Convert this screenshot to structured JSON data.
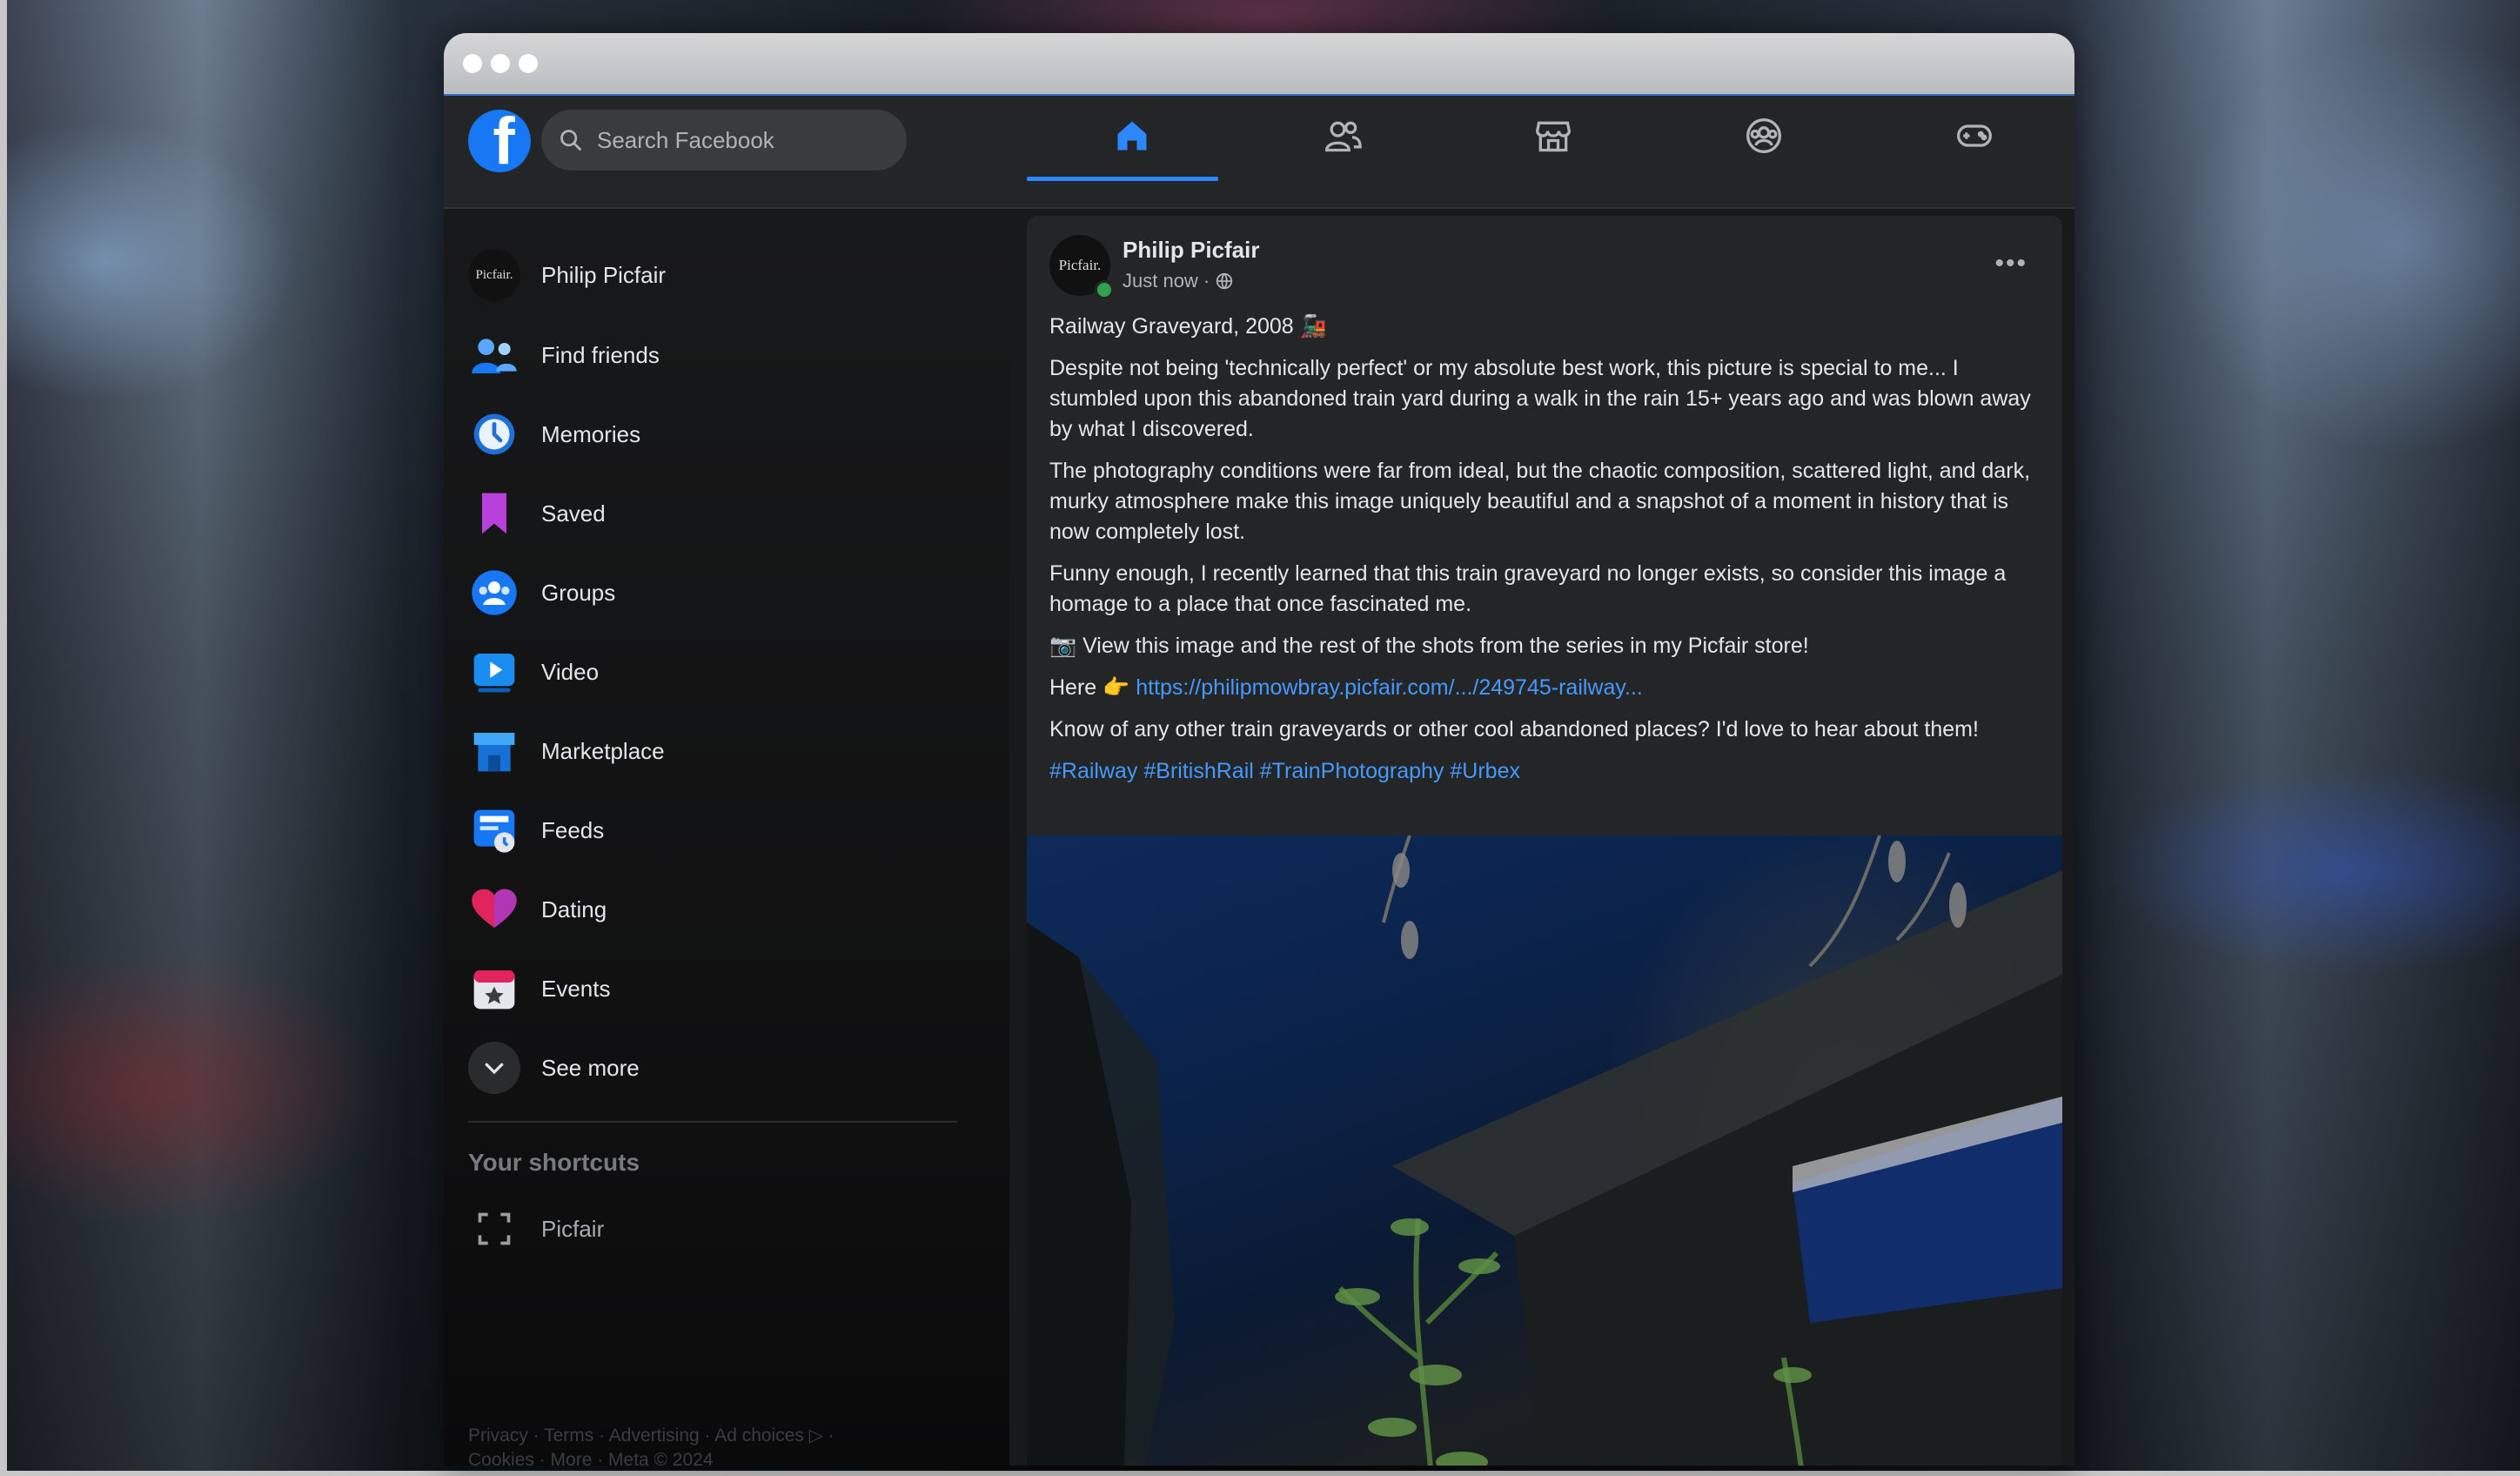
{
  "topnav": {
    "logo_letter": "f",
    "search_placeholder": "Search Facebook",
    "tabs": [
      "home-icon",
      "friends-icon",
      "marketplace-icon",
      "groups-icon",
      "gaming-icon"
    ],
    "active_tab": "home-icon",
    "accent_color": "#2d88ff"
  },
  "sidebar": {
    "avatar_text": "Picfair.",
    "items": [
      {
        "label": "Philip Picfair",
        "icon": "profile-avatar"
      },
      {
        "label": "Find friends",
        "icon": "friends-icon"
      },
      {
        "label": "Memories",
        "icon": "clock-icon"
      },
      {
        "label": "Saved",
        "icon": "bookmark-icon"
      },
      {
        "label": "Groups",
        "icon": "groups-icon"
      },
      {
        "label": "Video",
        "icon": "video-icon"
      },
      {
        "label": "Marketplace",
        "icon": "shop-icon"
      },
      {
        "label": "Feeds",
        "icon": "feeds-icon"
      },
      {
        "label": "Dating",
        "icon": "heart-icon"
      },
      {
        "label": "Events",
        "icon": "calendar-star-icon"
      },
      {
        "label": "See more",
        "icon": "chevron-down-icon"
      }
    ],
    "shortcuts_heading": "Your shortcuts",
    "shortcuts": [
      {
        "label": "Picfair",
        "icon": "expand-icon"
      }
    ],
    "footer_line1": "Privacy · Terms · Advertising · Ad choices ▷ ·",
    "footer_line2": "Cookies · More · Meta © 2024"
  },
  "post": {
    "author": "Philip Picfair",
    "avatar_text": "Picfair.",
    "time": "Just now ·",
    "title": "Railway Graveyard, 2008 🚂",
    "p1": "Despite not being 'technically perfect' or my absolute best work, this picture is special to me... I stumbled upon this abandoned train yard during a walk in the rain 15+ years ago and was blown away by what I discovered.",
    "p2": "The photography conditions were far from ideal, but the chaotic composition, scattered light, and dark, murky atmosphere make this image uniquely beautiful and a snapshot of a moment in history that is now completely lost.",
    "p3": "Funny enough, I recently learned that this train graveyard no longer exists, so consider this image a homage to a place that once fascinated me.",
    "p4": "📷 View this image and the rest of the shots from the series in my Picfair store!",
    "here_prefix": "Here 👉",
    "link": "https://philipmowbray.picfair.com/.../249745-railway...",
    "p5": "Know of any other train graveyards or other cool abandoned places? I'd love to hear about them!",
    "hashtags": "#Railway #BritishRail #TrainPhotography #Urbex",
    "more_label": "•••"
  }
}
